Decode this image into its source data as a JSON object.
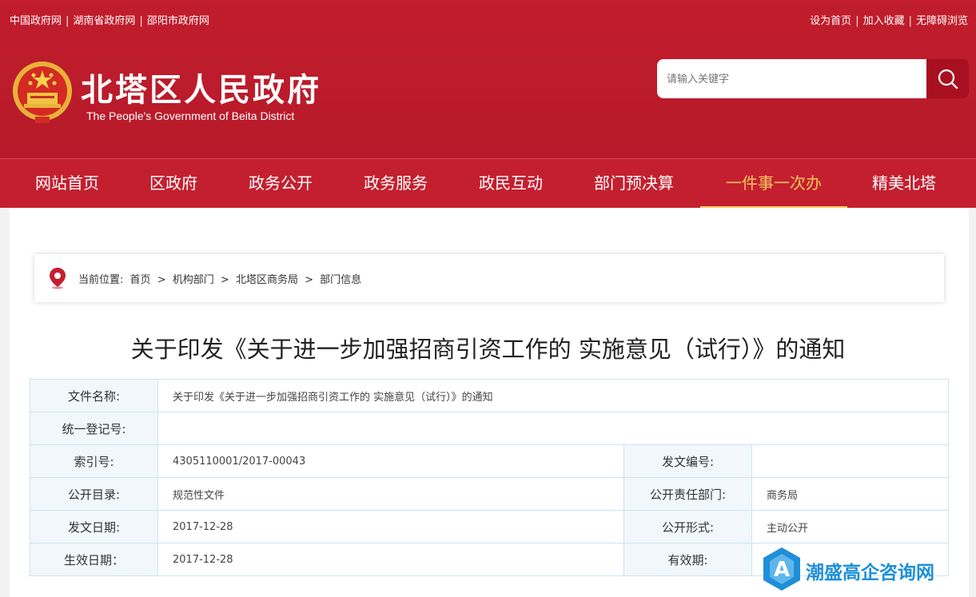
{
  "top_links": {
    "left": [
      "中国政府网",
      "湖南省政府网",
      "邵阳市政府网"
    ],
    "right": [
      "设为首页",
      "加入收藏",
      "无障碍浏览"
    ]
  },
  "site": {
    "title": "北塔区人民政府",
    "subtitle": "The People's Government of Beita District"
  },
  "search": {
    "placeholder": "请输入关键字"
  },
  "nav": {
    "items": [
      "网站首页",
      "区政府",
      "政务公开",
      "政务服务",
      "政民互动",
      "部门预决算",
      "一件事一次办",
      "精美北塔"
    ],
    "active_index": 6
  },
  "breadcrumb": {
    "label": "当前位置:",
    "items": [
      "首页",
      "机构部门",
      "北塔区商务局",
      "部门信息"
    ],
    "separator": ">"
  },
  "document": {
    "title": "关于印发《关于进一步加强招商引资工作的 实施意见（试行）》的通知"
  },
  "meta": {
    "file_name_label": "文件名称:",
    "file_name": "关于印发《关于进一步加强招商引资工作的 实施意见（试行）》的通知",
    "reg_no_label": "统一登记号:",
    "reg_no": "",
    "index_no_label": "索引号:",
    "index_no": "4305110001/2017-00043",
    "doc_no_label": "发文编号:",
    "doc_no": "",
    "catalog_label": "公开目录:",
    "catalog": "规范性文件",
    "dept_label": "公开责任部门:",
    "dept": "商务局",
    "issue_date_label": "发文日期:",
    "issue_date": "2017-12-28",
    "open_form_label": "公开形式:",
    "open_form": "主动公开",
    "effective_date_label": "生效日期：",
    "effective_date": "2017-12-28",
    "validity_label": "有效期:",
    "validity": ""
  },
  "watermark": {
    "text": "潮盛高企咨询网"
  },
  "colors": {
    "brand_red": "#c41f2f",
    "active_nav": "#f5c85f",
    "table_border": "#cfe3ef",
    "watermark_blue": "#1e8fd8"
  }
}
